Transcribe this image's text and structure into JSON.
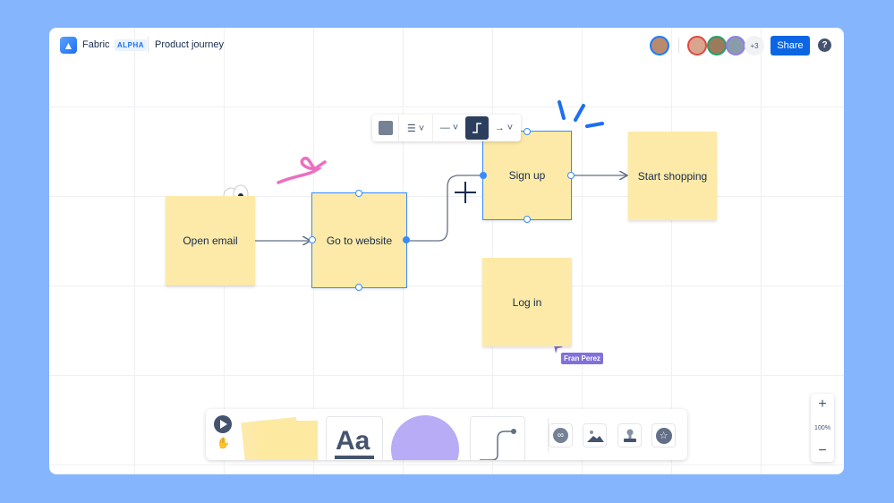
{
  "header": {
    "app_name": "Fabric",
    "badge": "ALPHA",
    "document_title": "Product journey",
    "share_label": "Share",
    "help_label": "?",
    "collaborators_more": "+3"
  },
  "notes": [
    {
      "id": "open-email",
      "label": "Open email"
    },
    {
      "id": "go-to-website",
      "label": "Go to website"
    },
    {
      "id": "sign-up",
      "label": "Sign up"
    },
    {
      "id": "start-shopping",
      "label": "Start shopping"
    },
    {
      "id": "log-in",
      "label": "Log in"
    }
  ],
  "remote_cursor": {
    "name": "Fran Perez",
    "color": "#8270db"
  },
  "connector_toolbar": {
    "items": [
      "color-swatch",
      "line-style",
      "line-type",
      "elbow-connector",
      "arrow-end"
    ]
  },
  "bottom_toolbar": {
    "text_tool_label": "Aa",
    "tools": [
      "select",
      "hand",
      "sticky-note",
      "text",
      "shape",
      "connector",
      "link",
      "image",
      "stamp",
      "sticker"
    ]
  },
  "zoom": {
    "in": "+",
    "level": "100%",
    "out": "−"
  },
  "colors": {
    "accent": "#0c66e4",
    "note": "#fdeaa8",
    "selection": "#388bff",
    "shape": "#b8acf6",
    "background": "#85b5fc"
  }
}
